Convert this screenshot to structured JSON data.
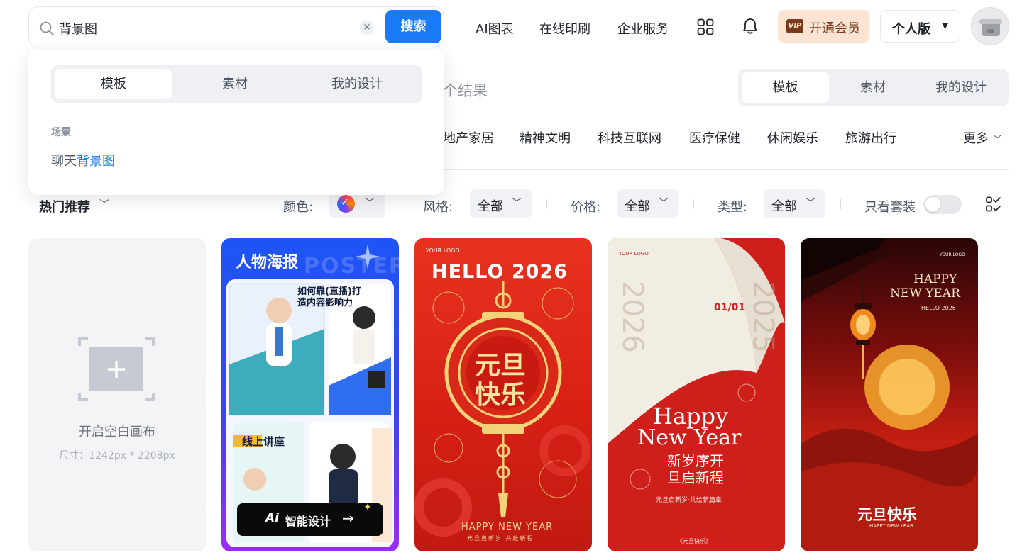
{
  "search": {
    "query": "背景图",
    "clear_symbol": "×",
    "button": "搜索"
  },
  "nav": {
    "links": [
      "AI图表",
      "在线印刷",
      "企业服务"
    ],
    "vip_badge": "VIP",
    "vip_label": "开通会员",
    "edition": "个人版"
  },
  "dropdown": {
    "tabs": [
      "模板",
      "素材",
      "我的设计"
    ],
    "section": "场景",
    "suggestion_prefix": "聊天",
    "suggestion_highlight": "背景图"
  },
  "results": {
    "count_fragment": "个结果",
    "tabs": [
      "模板",
      "素材",
      "我的设计"
    ]
  },
  "categories": {
    "items": [
      "地产家居",
      "精神文明",
      "科技互联网",
      "医疗保健",
      "休闲娱乐",
      "旅游出行"
    ],
    "more": "更多"
  },
  "filters": {
    "sort": "热门推荐",
    "color_label": "颜色:",
    "style_label": "风格:",
    "style_value": "全部",
    "price_label": "价格:",
    "price_value": "全部",
    "type_label": "类型:",
    "type_value": "全部",
    "only_sets": "只看套装",
    "only_sets_on": false
  },
  "blank_canvas": {
    "title": "开启空白画布",
    "size": "尺寸：1242px * 2208px"
  },
  "cards": [
    {
      "title": "人物海报",
      "watermark": "POSTERS",
      "ai_button_badge": "Ai",
      "ai_button": "智能设计",
      "arrow": "→",
      "mini_title": "如何靠(直播)打造内容影响力",
      "mini_title_2": "线上讲座"
    },
    {
      "logo": "YOUR LOGO",
      "headline": "HELLO 2026",
      "lantern_text_1": "元旦",
      "lantern_text_2": "快乐",
      "footer": "HAPPY NEW YEAR",
      "footer_cn": "元旦启新岁 共赴新程"
    },
    {
      "logo": "YOUR LOGO",
      "year_left": "2026",
      "year_right": "2025",
      "date": "01/01",
      "happy": "Happy",
      "new_year": "New Year",
      "cn_line_1": "新岁序开",
      "cn_line_2": "旦启新程",
      "tagline": "元旦启新岁·共绘新篇章",
      "footer": "《元旦快乐》"
    },
    {
      "logo": "YOUR LOGO",
      "happy": "HAPPY",
      "new_year": "NEW YEAR",
      "hello": "HELLO 2026",
      "cn_title": "元旦快乐",
      "sub": "HAPPY NEW YEAR"
    }
  ],
  "colors": {
    "accent": "#1a7af8",
    "vip_bg": "#fde3d4",
    "vip_text": "#7a3b1b",
    "festive_red": "#d51f14",
    "gold": "#f3d27a"
  }
}
